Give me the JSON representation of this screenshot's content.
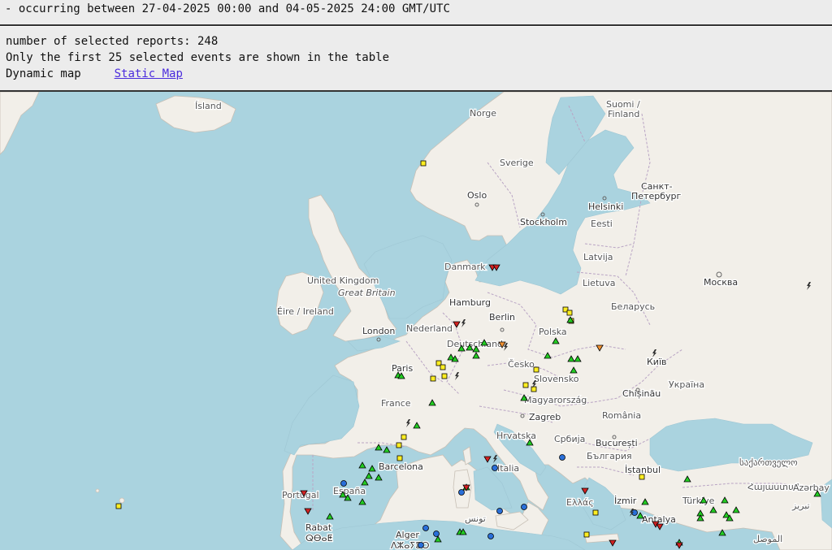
{
  "header": {
    "period": "- occurring between 27-04-2025 00:00 and 04-05-2025 24:00 GMT/UTC"
  },
  "info": {
    "selected_count_line": "number of selected reports: 248",
    "table_note": "Only the first 25 selected events are shown in the table",
    "dynamic_map_label": "Dynamic map",
    "static_map_link": "Static Map"
  },
  "map": {
    "colors": {
      "sea": "#aad3df",
      "land": "#f2efe9",
      "border": "#b9a4c4",
      "marker_green": "#22cc22",
      "marker_yellow": "#ffee22",
      "marker_red": "#d22222",
      "marker_orange": "#f09030",
      "marker_blue": "#2a6fd8"
    },
    "labels": {
      "island": "Ísland",
      "norge": "Norge",
      "sverige": "Sverige",
      "suomi": "Suomi /",
      "finland": "Finland",
      "oslo": "Oslo",
      "stockholm": "Stockholm",
      "helsinki": "Helsinki",
      "spb1": "Санкт-",
      "spb2": "Петербург",
      "eesti": "Eesti",
      "latvija": "Latvija",
      "lietuva": "Lietuva",
      "danmark": "Danmark",
      "moskva": "Москва",
      "belarus": "Беларусь",
      "uk": "United Kingdom",
      "gb": "Great Britain",
      "eire": "Éire / Ireland",
      "london": "London",
      "hamburg": "Hamburg",
      "berlin": "Berlin",
      "nederland": "Nederland",
      "polska": "Polska",
      "deutschland": "Deutschland",
      "kyiv": "Київ",
      "ukraina": "Україна",
      "paris": "Paris",
      "cesko": "Česko",
      "slovensko": "Slovensko",
      "chisinau": "Chișinău",
      "france": "France",
      "magyarorszag": "Magyarország",
      "zagreb": "Zagreb",
      "romania": "România",
      "hrvatska": "Hrvatska",
      "srbija": "Србија",
      "bucuresti": "București",
      "bulgaria": "България",
      "barcelona": "Barcelona",
      "italia": "Italia",
      "istanbul": "İstanbul",
      "georgia": "საქართველო",
      "armenia": "Հայաստան",
      "azerbaijan": "Azərbay",
      "portugal": "Portugal",
      "espana": "España",
      "izmir": "İzmir",
      "turkiye": "Türkiye",
      "ellas": "Ελλάς",
      "antalya": "Antalya",
      "tabriz": "تبریز",
      "tunis": "تونس",
      "rabat": "Rabat",
      "rabat_tif": "ⵕⴱⴰⵟ",
      "alger": "Alger",
      "alger_tif": "ⴷⵣⴰⵢⴻⵔ",
      "mosul": "الموصل"
    }
  }
}
